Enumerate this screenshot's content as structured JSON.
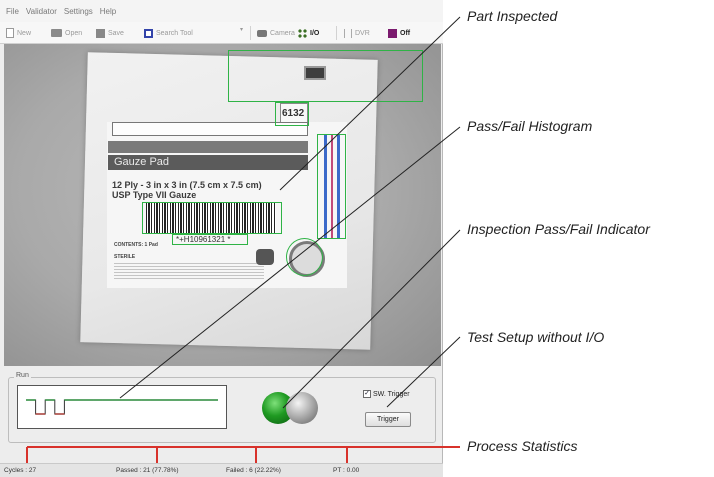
{
  "menu": [
    "File",
    "Validator",
    "Settings",
    "Help"
  ],
  "toolbar": {
    "new": "New",
    "open": "Open",
    "save": "Save",
    "search": "Search Tool",
    "camera": "Camera",
    "io": "I/O",
    "dvr": "DVR",
    "off": "Off"
  },
  "label": {
    "lot": "6132",
    "title": "Gauze Pad",
    "spec1": "12 Ply - 3 in x 3 in (7.5 cm x 7.5 cm)",
    "spec2": "USP Type VII Gauze",
    "barcode_text": "*+H10961321 *",
    "contents": "CONTENTS: 1 Pad",
    "sterile": "STERILE"
  },
  "run": {
    "title": "Run",
    "sw_trigger_label": "SW. Trigger",
    "sw_trigger_checked": "✓",
    "trigger_button": "Trigger",
    "histogram": [
      1,
      0,
      1,
      0,
      1,
      1,
      1,
      1,
      1,
      1,
      1,
      1,
      1,
      1,
      1,
      1,
      1,
      1,
      1,
      1
    ]
  },
  "status": {
    "cycles": "Cycles : 27",
    "passed": "Passed : 21 (77.78%)",
    "failed": "Failed : 6 (22.22%)",
    "pt": "PT : 0.00"
  },
  "callouts": {
    "part_inspected": "Part Inspected",
    "histogram": "Pass/Fail Histogram",
    "indicator": "Inspection Pass/Fail Indicator",
    "setup": "Test Setup without I/O",
    "statistics": "Process Statistics"
  },
  "colors": {
    "roi": "#2fb346",
    "pass_light": "#1f9a22",
    "histogram_pass": "#2fb346",
    "histogram_fail": "#d8463c",
    "stat_marker": "#d8322b",
    "off_indicator": "#7b1a6e"
  }
}
